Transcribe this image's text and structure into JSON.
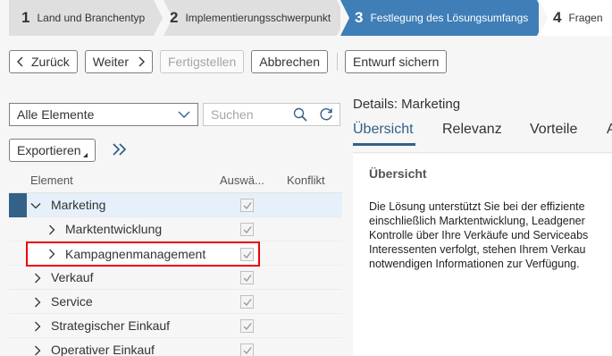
{
  "wizard": {
    "steps": [
      {
        "num": "1",
        "label": "Land und Branchentyp",
        "state": "done"
      },
      {
        "num": "2",
        "label": "Implementierungsschwerpunkt",
        "state": "done"
      },
      {
        "num": "3",
        "label": "Festlegung des Lösungsumfangs",
        "state": "active"
      },
      {
        "num": "4",
        "label": "Fragen",
        "state": "upcoming"
      }
    ]
  },
  "toolbar": {
    "back": "Zurück",
    "next": "Weiter",
    "finish": "Fertigstellen",
    "cancel": "Abbrechen",
    "save_draft": "Entwurf sichern"
  },
  "left": {
    "filter_value": "Alle Elemente",
    "search_placeholder": "Suchen",
    "export_label": "Exportieren",
    "columns": {
      "element": "Element",
      "selected": "Auswä...",
      "conflict": "Konflikt"
    },
    "rows": [
      {
        "label": "Marketing",
        "level": 0,
        "expanded": true,
        "checked": true
      },
      {
        "label": "Marktentwicklung",
        "level": 1,
        "expanded": false,
        "checked": true
      },
      {
        "label": "Kampagnenmanagement",
        "level": 1,
        "expanded": false,
        "checked": true
      },
      {
        "label": "Verkauf",
        "level": 0,
        "expanded": false,
        "checked": true
      },
      {
        "label": "Service",
        "level": 0,
        "expanded": false,
        "checked": true
      },
      {
        "label": "Strategischer Einkauf",
        "level": 0,
        "expanded": false,
        "checked": true
      },
      {
        "label": "Operativer Einkauf",
        "level": 0,
        "expanded": false,
        "checked": true
      }
    ]
  },
  "right": {
    "title": "Details: Marketing",
    "tabs": [
      "Übersicht",
      "Relevanz",
      "Vorteile",
      "A"
    ],
    "section_title": "Übersicht",
    "text_lines": [
      "Die Lösung unterstützt Sie bei der effiziente",
      "einschließlich Marktentwicklung, Leadgener",
      "Kontrolle über Ihre Verkäufe und Serviceabs",
      "Interessenten verfolgt, stehen Ihrem Verkau",
      "notwendigen Informationen zur Verfügung."
    ]
  },
  "colors": {
    "active_step": "#3f7eb6",
    "done_step": "#dfdfdf",
    "accent": "#346187",
    "highlight": "#e00000"
  }
}
